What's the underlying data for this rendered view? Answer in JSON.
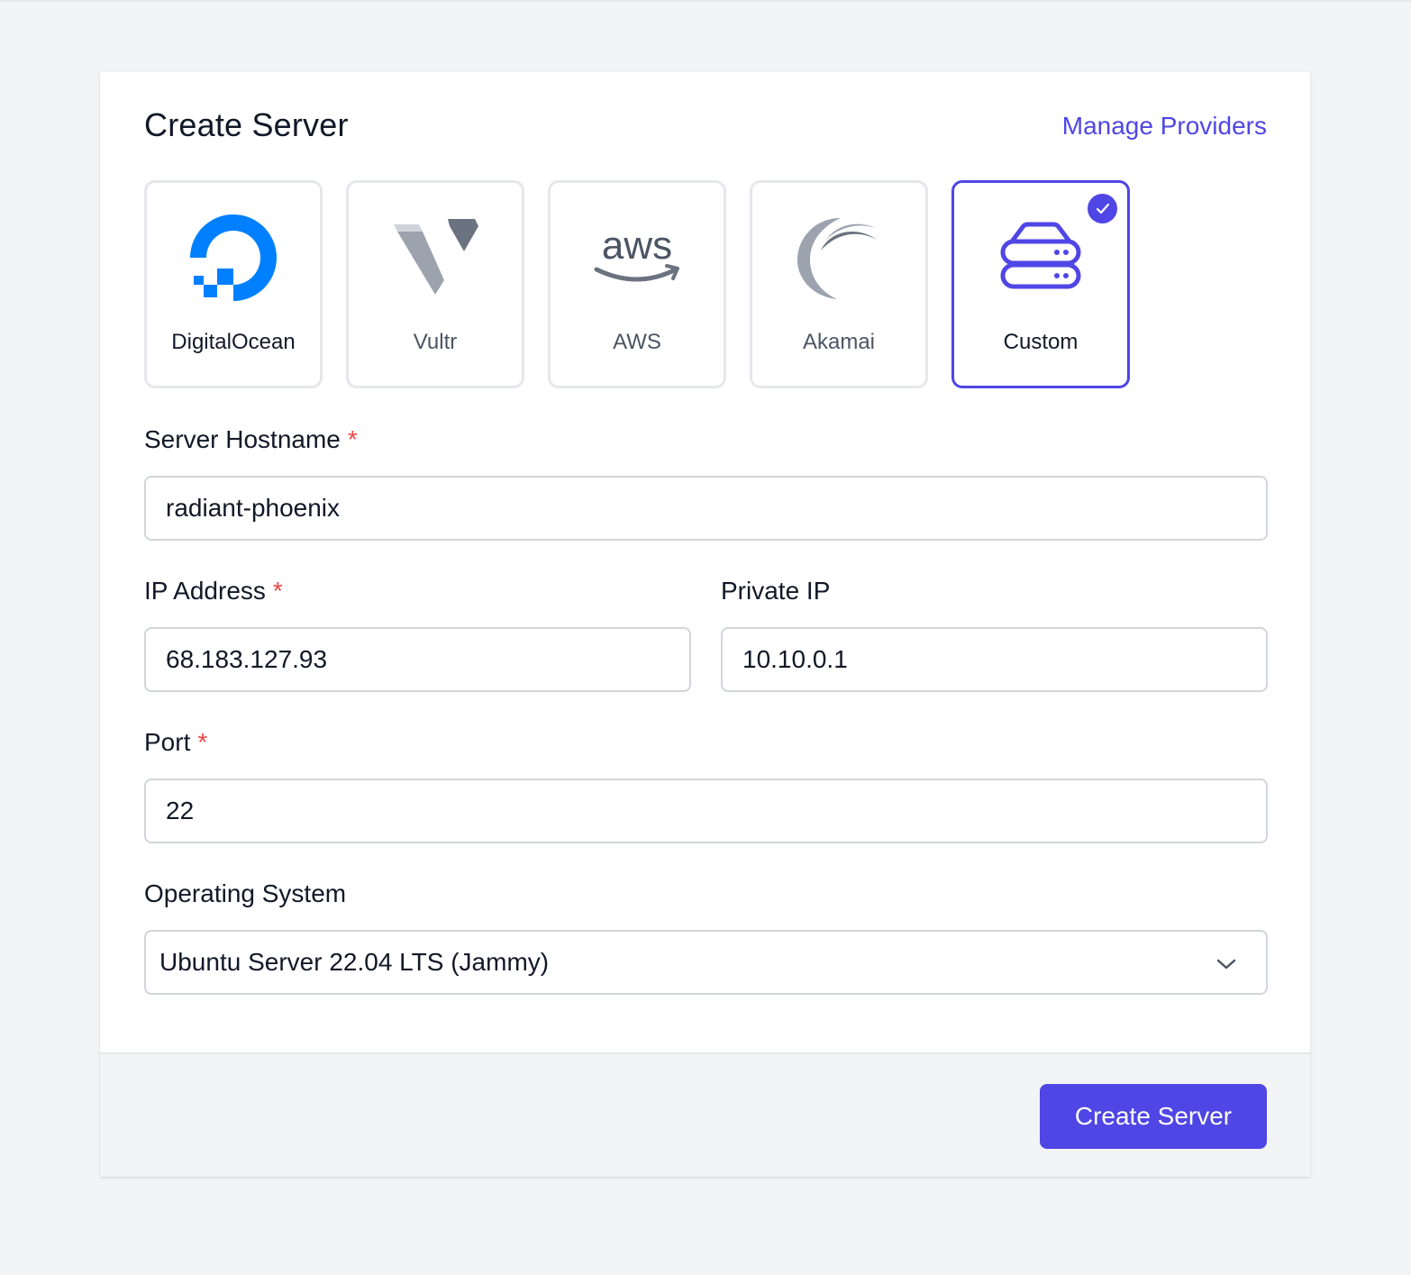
{
  "header": {
    "title": "Create Server",
    "manage_link": "Manage Providers"
  },
  "providers": [
    {
      "label": "DigitalOcean",
      "icon": "digitalocean-logo-icon",
      "selected": false
    },
    {
      "label": "Vultr",
      "icon": "vultr-logo-icon",
      "selected": false
    },
    {
      "label": "AWS",
      "icon": "aws-logo-icon",
      "logo_text": "aws",
      "selected": false
    },
    {
      "label": "Akamai",
      "icon": "akamai-logo-icon",
      "selected": false
    },
    {
      "label": "Custom",
      "icon": "server-stack-icon",
      "selected": true
    }
  ],
  "form": {
    "hostname": {
      "label": "Server Hostname",
      "required_mark": "*",
      "value": "radiant-phoenix"
    },
    "ip_address": {
      "label": "IP Address",
      "required_mark": "*",
      "value": "68.183.127.93"
    },
    "private_ip": {
      "label": "Private IP",
      "value": "10.10.0.1"
    },
    "port": {
      "label": "Port",
      "required_mark": "*",
      "value": "22"
    },
    "os": {
      "label": "Operating System",
      "value": "Ubuntu Server 22.04 LTS (Jammy)"
    }
  },
  "footer": {
    "submit_label": "Create Server"
  },
  "colors": {
    "accent": "#4f46e5",
    "required": "#ef4444",
    "digitalocean_blue": "#0080ff",
    "border": "#d1d5db"
  }
}
